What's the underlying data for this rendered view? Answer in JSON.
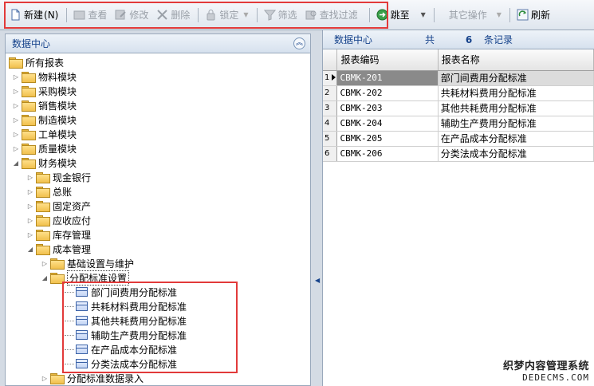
{
  "toolbar": {
    "new_label": "新建",
    "new_shortcut": "(N)",
    "view_label": "查看",
    "edit_label": "修改",
    "delete_label": "删除",
    "lock_label": "锁定",
    "filter_label": "筛选",
    "find_filter_label": "查找过滤",
    "jump_label": "跳至",
    "other_ops_label": "其它操作",
    "refresh_label": "刷新"
  },
  "left_panel": {
    "title": "数据中心",
    "tree": [
      {
        "label": "所有报表",
        "level": 0,
        "state": "expanded"
      },
      {
        "label": "物料模块",
        "level": 1,
        "state": "collapsed"
      },
      {
        "label": "采购模块",
        "level": 1,
        "state": "collapsed"
      },
      {
        "label": "销售模块",
        "level": 1,
        "state": "collapsed"
      },
      {
        "label": "制造模块",
        "level": 1,
        "state": "collapsed"
      },
      {
        "label": "工单模块",
        "level": 1,
        "state": "collapsed"
      },
      {
        "label": "质量模块",
        "level": 1,
        "state": "collapsed"
      },
      {
        "label": "财务模块",
        "level": 1,
        "state": "expanded"
      },
      {
        "label": "现金银行",
        "level": 2,
        "state": "collapsed"
      },
      {
        "label": "总账",
        "level": 2,
        "state": "collapsed"
      },
      {
        "label": "固定资产",
        "level": 2,
        "state": "collapsed"
      },
      {
        "label": "应收应付",
        "level": 2,
        "state": "collapsed"
      },
      {
        "label": "库存管理",
        "level": 2,
        "state": "collapsed"
      },
      {
        "label": "成本管理",
        "level": 2,
        "state": "expanded"
      },
      {
        "label": "基础设置与维护",
        "level": 3,
        "state": "collapsed"
      },
      {
        "label": "分配标准设置",
        "level": 3,
        "state": "expanded",
        "selected": true
      },
      {
        "label": "部门间费用分配标准",
        "level": 4,
        "state": "leaf"
      },
      {
        "label": "共耗材料费用分配标准",
        "level": 4,
        "state": "leaf"
      },
      {
        "label": "其他共耗费用分配标准",
        "level": 4,
        "state": "leaf"
      },
      {
        "label": "辅助生产费用分配标准",
        "level": 4,
        "state": "leaf"
      },
      {
        "label": "在产品成本分配标准",
        "level": 4,
        "state": "leaf"
      },
      {
        "label": "分类法成本分配标准",
        "level": 4,
        "state": "leaf"
      },
      {
        "label": "分配标准数据录入",
        "level": 3,
        "state": "collapsed"
      }
    ]
  },
  "right_panel": {
    "title": "数据中心",
    "count_prefix": "共",
    "count": "6",
    "count_suffix": "条记录",
    "columns": [
      "报表编码",
      "报表名称"
    ],
    "rows": [
      {
        "num": "1",
        "code": "CBMK-201",
        "name": "部门间费用分配标准",
        "selected": true
      },
      {
        "num": "2",
        "code": "CBMK-202",
        "name": "共耗材料费用分配标准"
      },
      {
        "num": "3",
        "code": "CBMK-203",
        "name": "其他共耗费用分配标准"
      },
      {
        "num": "4",
        "code": "CBMK-204",
        "name": "辅助生产费用分配标准"
      },
      {
        "num": "5",
        "code": "CBMK-205",
        "name": "在产品成本分配标准"
      },
      {
        "num": "6",
        "code": "CBMK-206",
        "name": "分类法成本分配标准"
      }
    ]
  },
  "watermark": {
    "line1": "织梦内容管理系统",
    "line2": "DEDECMS.COM"
  },
  "colors": {
    "highlight_border": "#e23a3a",
    "header_text": "#15428b"
  }
}
